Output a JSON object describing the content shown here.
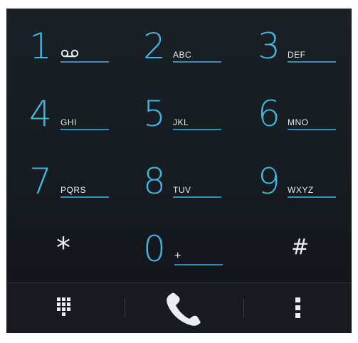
{
  "keys": [
    {
      "digit": "1",
      "letters": ""
    },
    {
      "digit": "2",
      "letters": "ABC"
    },
    {
      "digit": "3",
      "letters": "DEF"
    },
    {
      "digit": "4",
      "letters": "GHI"
    },
    {
      "digit": "5",
      "letters": "JKL"
    },
    {
      "digit": "6",
      "letters": "MNO"
    },
    {
      "digit": "7",
      "letters": "PQRS"
    },
    {
      "digit": "8",
      "letters": "TUV"
    },
    {
      "digit": "9",
      "letters": "WXYZ"
    },
    {
      "digit": "*",
      "letters": ""
    },
    {
      "digit": "0",
      "letters": "+"
    },
    {
      "digit": "#",
      "letters": ""
    }
  ],
  "icons": {
    "voicemail": "voicemail-icon",
    "dialpad": "dialpad-icon",
    "call": "call-icon",
    "overflow": "overflow-menu-icon"
  },
  "colors": {
    "accent": "#3fb6e4",
    "background": "#161b20",
    "text": "#e8eef2"
  }
}
